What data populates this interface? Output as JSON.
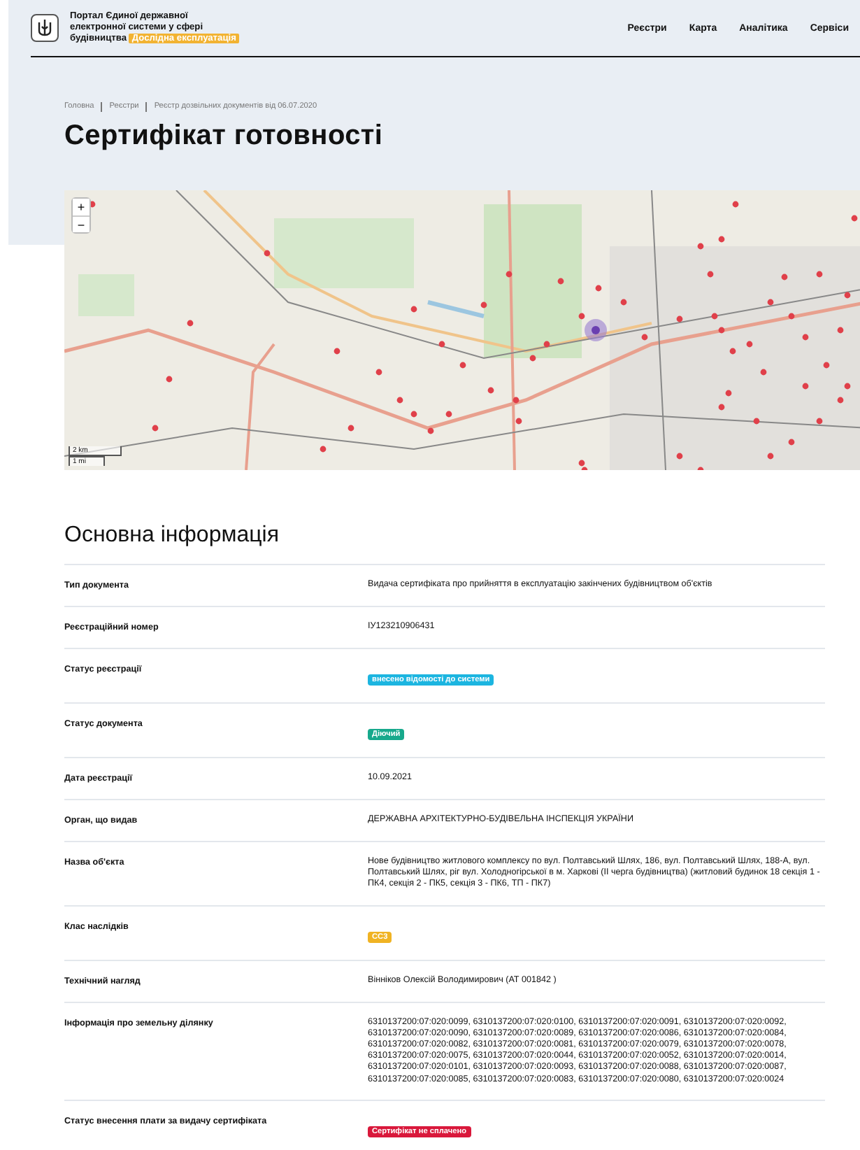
{
  "header": {
    "portal_title": "Портал Єдиної державної електронної системи у сфері будівництва",
    "badge": "Дослідна експлуатація",
    "nav": [
      {
        "label": "Реєстри"
      },
      {
        "label": "Карта"
      },
      {
        "label": "Аналітика"
      },
      {
        "label": "Сервіси"
      }
    ]
  },
  "breadcrumbs": [
    "Головна",
    "Реєстри",
    "Реєстр дозвільних документів від 06.07.2020"
  ],
  "page_title": "Сертифікат готовності",
  "map": {
    "zoom_in": "+",
    "zoom_out": "−",
    "scale": [
      "2 km",
      "1 mi"
    ]
  },
  "section_title": "Основна інформація",
  "rows": [
    {
      "label": "Тип документа",
      "kind": "text",
      "value": "Видача сертифіката про прийняття в експлуатацію закінчених будівництвом об'єктів"
    },
    {
      "label": "Реєстраційний номер",
      "kind": "text",
      "value": "ІУ123210906431"
    },
    {
      "label": "Статус реєстрації",
      "kind": "badge",
      "value": "внесено відомості до системи",
      "color": "#1cb5e0"
    },
    {
      "label": "Статус документа",
      "kind": "badge",
      "value": "Діючий",
      "color": "#17a98c"
    },
    {
      "label": "Дата реєстрації",
      "kind": "text",
      "value": "10.09.2021"
    },
    {
      "label": "Орган, що видав",
      "kind": "text",
      "value": "ДЕРЖАВНА АРХІТЕКТУРНО-БУДІВЕЛЬНА ІНСПЕКЦІЯ УКРАЇНИ"
    },
    {
      "label": "Назва об'єкта",
      "kind": "text",
      "value": "Нове будівництво житлового комплексу по вул. Полтавський Шлях, 186, вул. Полтавський Шлях, 188-А, вул. Полтавський Шлях, ріг вул. Холодногірської в м. Харкові (ІІ черга будівництва) (житловий будинок 18 секція 1 - ПК4, секція 2 - ПК5, секція 3 - ПК6, ТП - ПК7)"
    },
    {
      "label": "Клас наслідків",
      "kind": "badge",
      "value": "СС3",
      "color": "#f0b323"
    },
    {
      "label": "Технічний нагляд",
      "kind": "text",
      "value": "Вінніков Олексій Володимирович (АТ 001842 )"
    },
    {
      "label": "Інформація про земельну ділянку",
      "kind": "text",
      "value": "6310137200:07:020:0099, 6310137200:07:020:0100, 6310137200:07:020:0091, 6310137200:07:020:0092, 6310137200:07:020:0090, 6310137200:07:020:0089, 6310137200:07:020:0086, 6310137200:07:020:0084, 6310137200:07:020:0082, 6310137200:07:020:0081, 6310137200:07:020:0079, 6310137200:07:020:0078, 6310137200:07:020:0075, 6310137200:07:020:0044, 6310137200:07:020:0052, 6310137200:07:020:0014, 6310137200:07:020:0101, 6310137200:07:020:0093, 6310137200:07:020:0088, 6310137200:07:020:0087, 6310137200:07:020:0085, 6310137200:07:020:0083, 6310137200:07:020:0080, 6310137200:07:020:0024"
    },
    {
      "label": "Статус внесення плати за видачу сертифіката",
      "kind": "badge",
      "value": "Сертифікат не сплачено",
      "color": "#d9183b"
    }
  ]
}
